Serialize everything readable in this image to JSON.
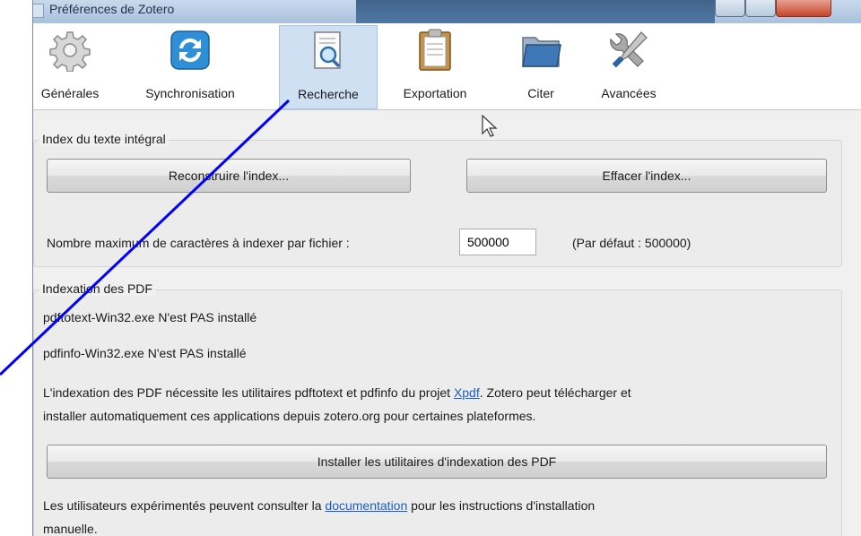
{
  "window": {
    "title": "Préférences de Zotero"
  },
  "toolbar": {
    "items": [
      {
        "label": "Générales",
        "icon": "gear-icon"
      },
      {
        "label": "Synchronisation",
        "icon": "sync-icon"
      },
      {
        "label": "Recherche",
        "icon": "search-document-icon",
        "active": true
      },
      {
        "label": "Exportation",
        "icon": "clipboard-icon"
      },
      {
        "label": "Citer",
        "icon": "folder-icon"
      },
      {
        "label": "Avancées",
        "icon": "tools-icon"
      }
    ]
  },
  "fulltext": {
    "legend": "Index du texte intégral",
    "rebuild_label": "Reconstruire l'index...",
    "clear_label": "Effacer l'index...",
    "max_chars_label": "Nombre maximum de caractères à indexer par fichier :",
    "max_chars_value": "500000",
    "default_note": "(Par défaut : 500000)"
  },
  "pdf": {
    "legend": "Indexation des PDF",
    "pdftotext_status": "pdftotext-Win32.exe N'est PAS installé",
    "pdfinfo_status": "pdfinfo-Win32.exe N'est PAS installé",
    "info_before": "L'indexation des PDF nécessite les utilitaires pdftotext et pdfinfo du projet ",
    "info_link": "Xpdf",
    "info_after": ". Zotero peut télécharger et",
    "info_line2": "installer automatiquement ces applications depuis zotero.org pour certaines plateformes.",
    "install_label": "Installer les utilitaires d'indexation des PDF",
    "advanced_before": "Les utilisateurs expérimentés peuvent consulter la ",
    "advanced_link": "documentation",
    "advanced_after": " pour les instructions d'installation",
    "advanced_line2": "manuelle."
  },
  "colors": {
    "accent": "#cfe0f3",
    "link": "#1a5fc9",
    "annotation": "#0000ff"
  }
}
